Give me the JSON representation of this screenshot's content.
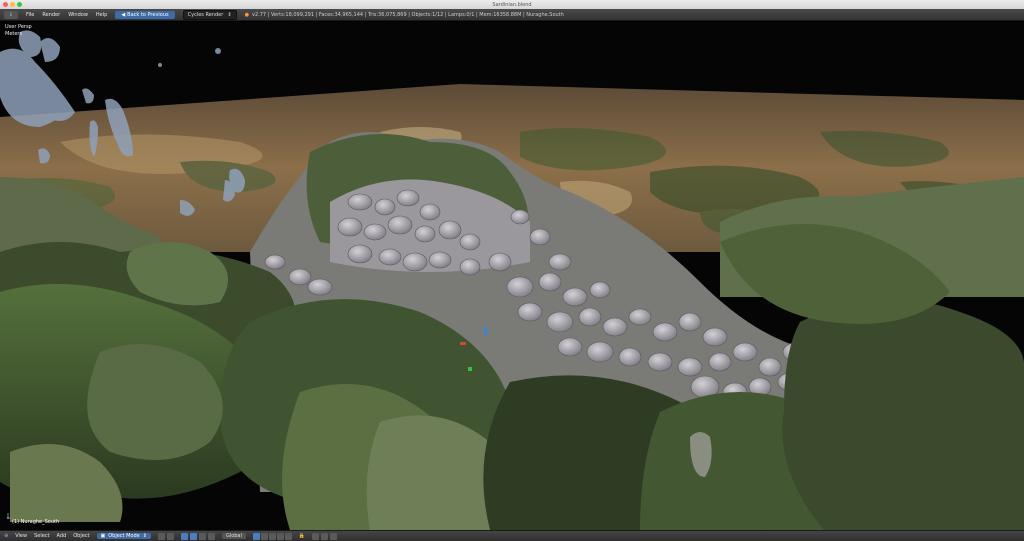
{
  "window": {
    "title": "Sardinian.blend"
  },
  "menubar": {
    "items": [
      "File",
      "Render",
      "Window",
      "Help"
    ],
    "back_button": "Back to Previous",
    "render_engine": "Cycles Render",
    "stats": "v2.77 | Verts:18,099,291 | Faces:34,965,144 | Tris:36,075,869 | Objects:1/12 | Lamps:0/1 | Mem:16358.88M | Nuraghe.South"
  },
  "viewport": {
    "view_label": "User Persp",
    "sub_label": "Meters",
    "object_label": "(1) Nuraghe_South"
  },
  "footer": {
    "items": [
      "View",
      "Select",
      "Add",
      "Object"
    ],
    "mode": "Object Mode",
    "pivot": "Global"
  },
  "colors": {
    "sky": "#050505",
    "field": "#8c6f4a",
    "vegetation": "#4f6a35",
    "stone": "#a9a6ad",
    "accent": "#3e6aa6"
  }
}
